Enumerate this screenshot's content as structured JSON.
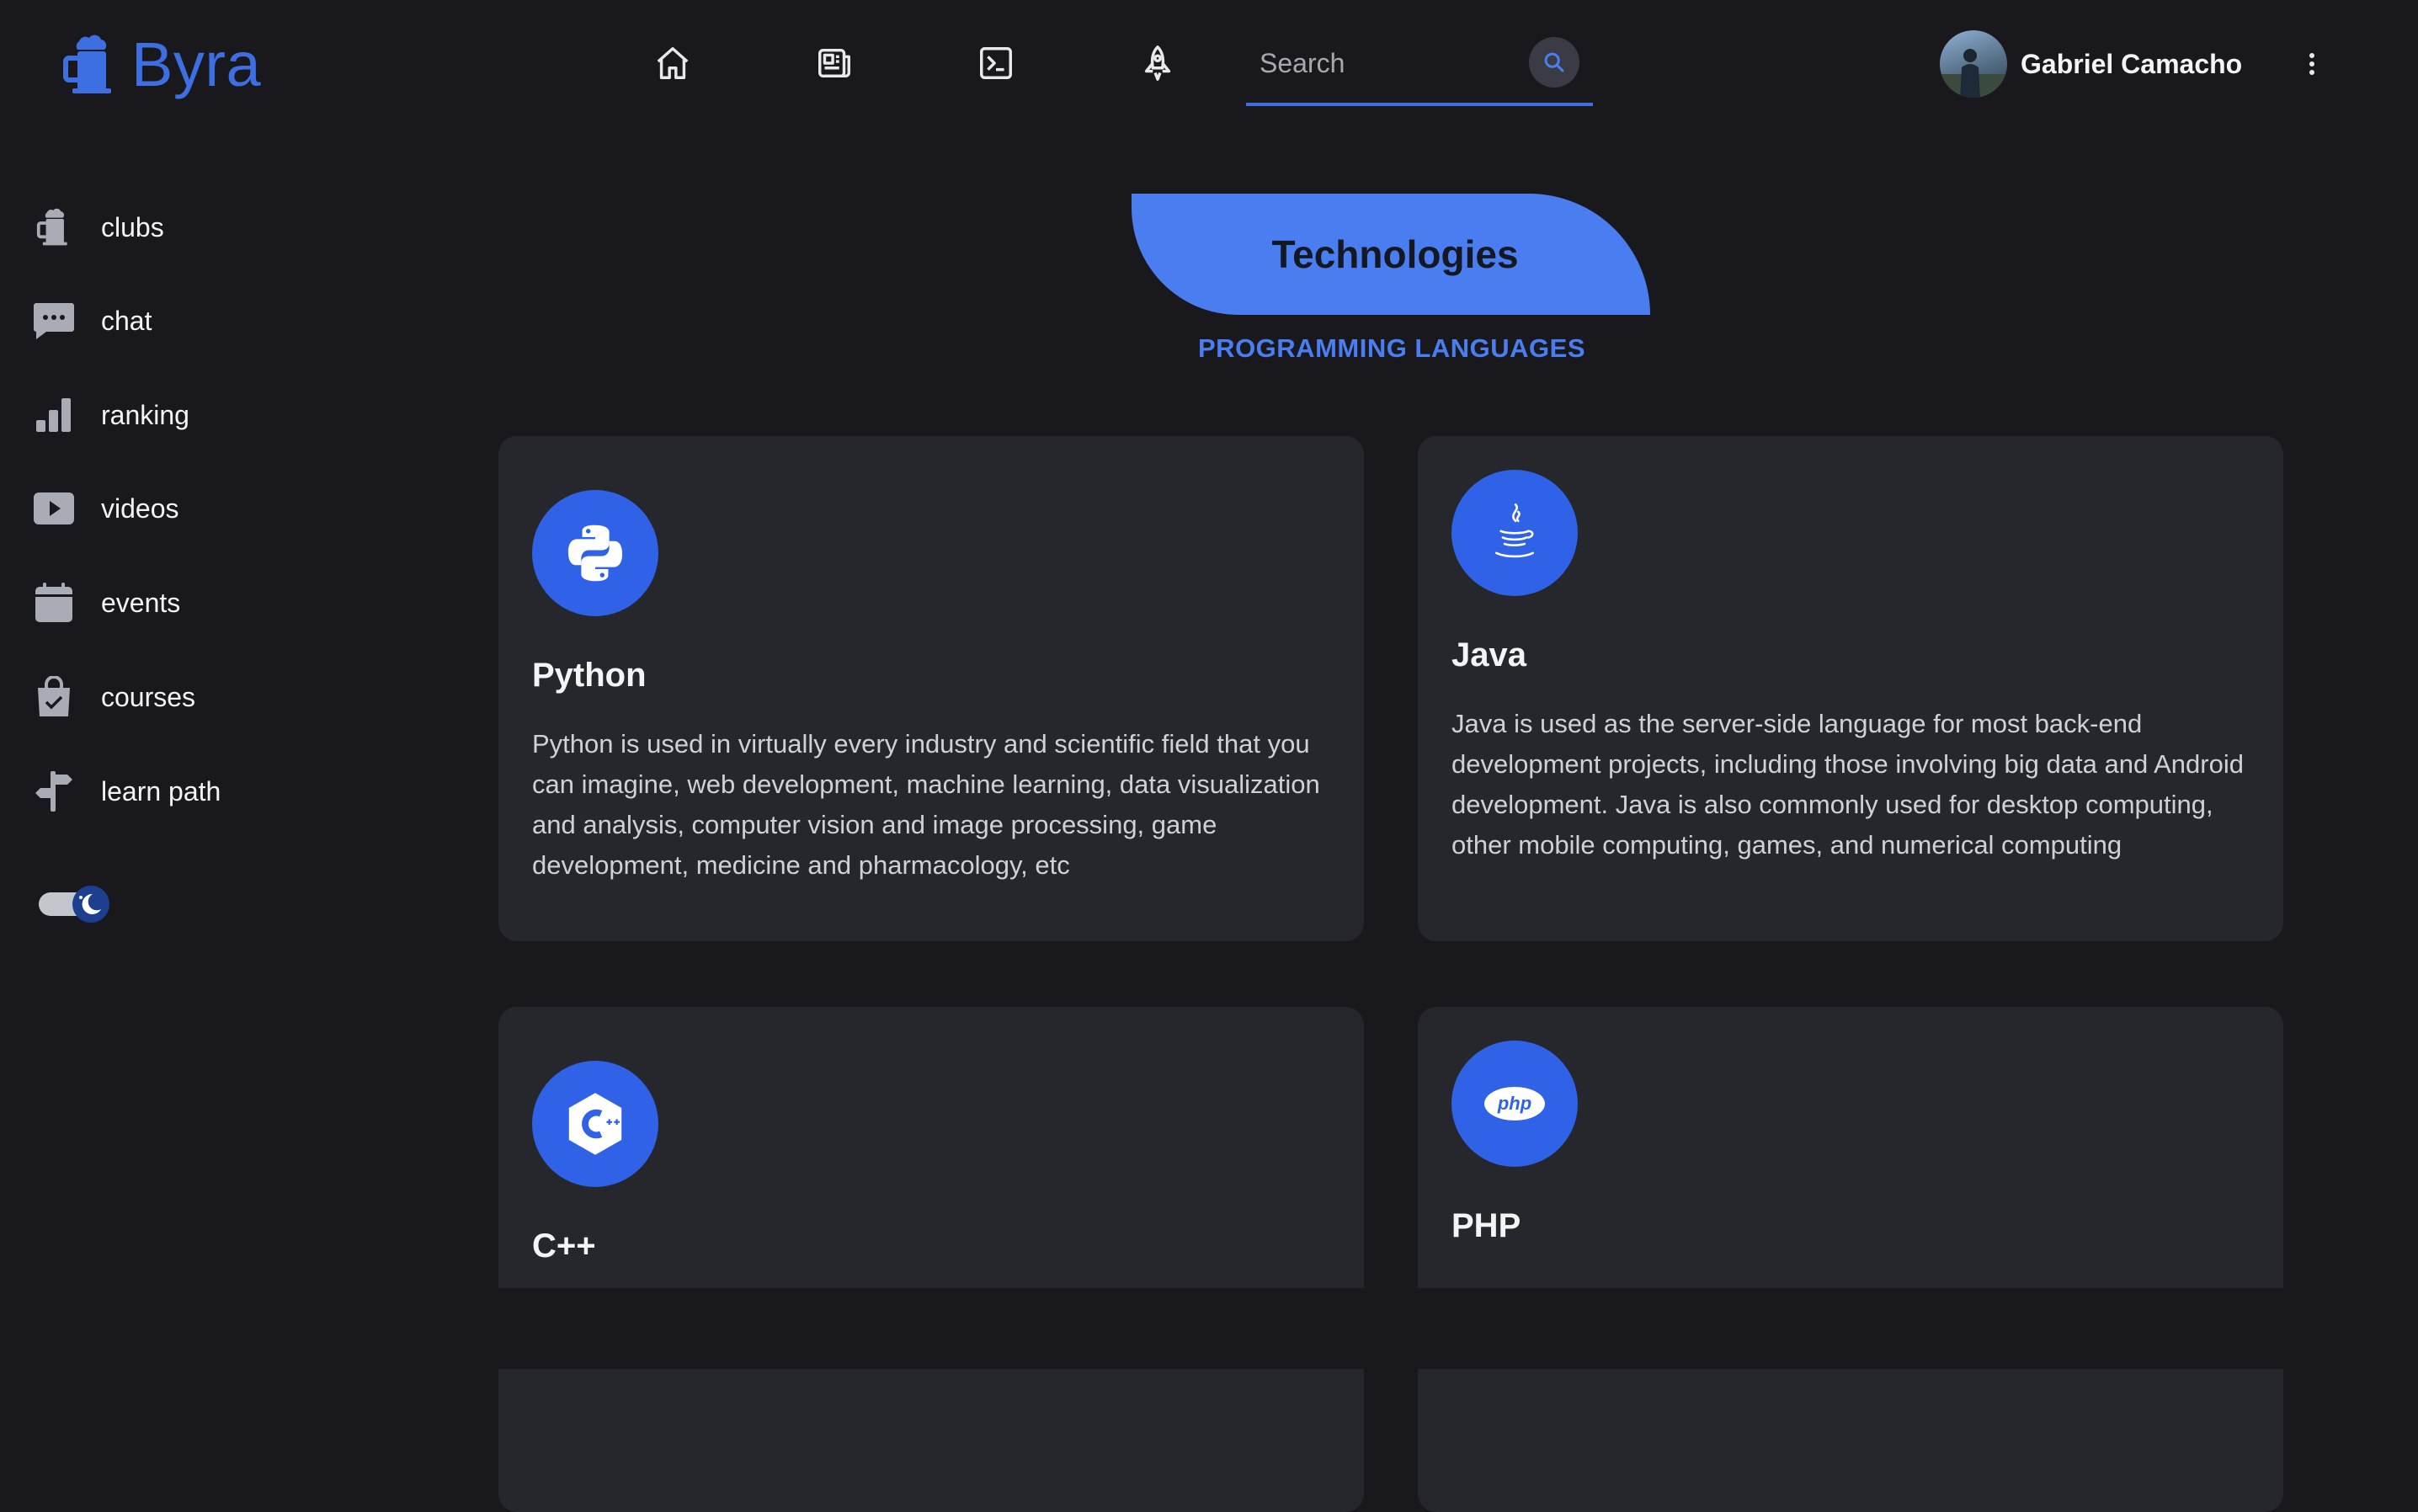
{
  "app": {
    "name": "Byra",
    "accent": "#3d6ee2"
  },
  "header": {
    "nav_icons": [
      "home-icon",
      "news-icon",
      "terminal-icon",
      "rocket-icon"
    ],
    "search": {
      "placeholder": "Search",
      "value": ""
    },
    "user": {
      "name": "Gabriel Camacho"
    }
  },
  "sidebar": {
    "items": [
      {
        "label": "clubs",
        "icon": "mug-icon"
      },
      {
        "label": "chat",
        "icon": "chat-bubble-icon"
      },
      {
        "label": "ranking",
        "icon": "bar-chart-icon"
      },
      {
        "label": "videos",
        "icon": "play-icon"
      },
      {
        "label": "events",
        "icon": "calendar-icon"
      },
      {
        "label": "courses",
        "icon": "shopping-bag-check-icon"
      },
      {
        "label": "learn path",
        "icon": "signpost-icon"
      }
    ],
    "theme_toggle": "dark"
  },
  "main": {
    "title": "Technologies",
    "subtitle": "PROGRAMMING LANGUAGES",
    "cards": [
      {
        "name": "Python",
        "icon": "python-icon",
        "description": "Python is used in virtually every industry and scientific field that you can imagine, web development, machine learning, data visualization and analysis, computer vision and image processing, game development, medicine and pharmacology, etc"
      },
      {
        "name": "Java",
        "icon": "java-icon",
        "description": "Java is used as the server-side language for most back-end development projects, including those involving big data and Android development. Java is also commonly used for desktop computing, other mobile computing, games, and numerical computing"
      },
      {
        "name": "C++",
        "icon": "cplusplus-icon",
        "description": ""
      },
      {
        "name": "PHP",
        "icon": "php-icon",
        "description": ""
      }
    ]
  }
}
